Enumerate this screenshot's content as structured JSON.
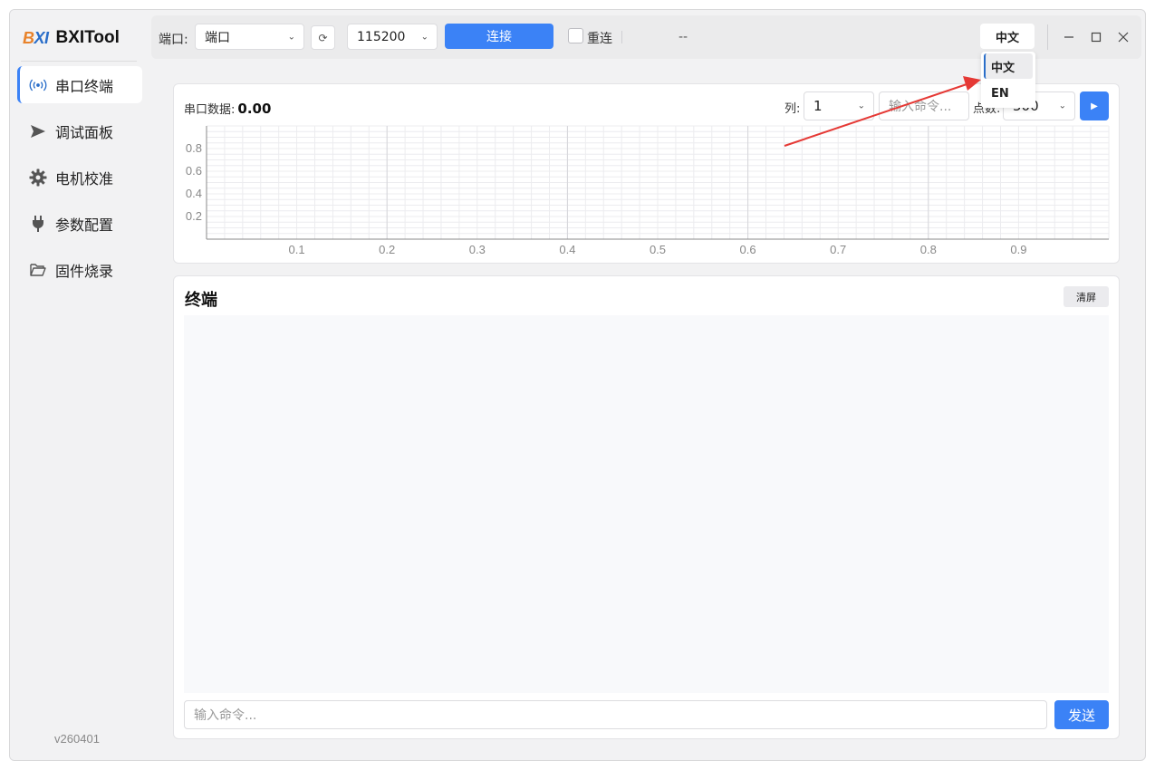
{
  "app": {
    "logo_b": "B",
    "logo_xi": "XI",
    "name": "BXITool",
    "version": "v260401"
  },
  "sidebar": {
    "items": [
      {
        "label": "串口终端",
        "icon": "radio-wave-icon",
        "active": true
      },
      {
        "label": "调试面板",
        "icon": "send-icon",
        "active": false
      },
      {
        "label": "电机校准",
        "icon": "gear-icon",
        "active": false
      },
      {
        "label": "参数配置",
        "icon": "plug-icon",
        "active": false
      },
      {
        "label": "固件烧录",
        "icon": "folder-open-icon",
        "active": false
      }
    ]
  },
  "topbar": {
    "port_label": "端口:",
    "port_value": "端口",
    "refresh_icon": "refresh-icon",
    "baud_value": "115200",
    "connect_label": "连接",
    "reconnect_label": "重连",
    "status_text": "--",
    "language_value": "中文"
  },
  "language_menu": {
    "options": [
      "中文",
      "EN"
    ],
    "selected": "中文"
  },
  "chart_panel": {
    "title": "串口数据:",
    "value": "0.00",
    "column_label": "列:",
    "column_value": "1",
    "command_placeholder": "输入命令...",
    "points_label": "点数:",
    "points_value": "500",
    "play_icon": "play-icon"
  },
  "chart_data": {
    "type": "line",
    "title": "",
    "xlabel": "",
    "ylabel": "",
    "x_ticks": [
      "0.1",
      "0.2",
      "0.3",
      "0.4",
      "0.5",
      "0.6",
      "0.7",
      "0.8",
      "0.9"
    ],
    "y_ticks": [
      "0.2",
      "0.4",
      "0.6",
      "0.8"
    ],
    "xlim": [
      0,
      1
    ],
    "ylim": [
      0,
      1
    ],
    "grid": true,
    "series": []
  },
  "terminal": {
    "title": "终端",
    "clear_label": "清屏",
    "input_placeholder": "输入命令...",
    "send_label": "发送"
  },
  "colors": {
    "accent": "#3b82f6",
    "annotation_arrow": "#e53935"
  }
}
